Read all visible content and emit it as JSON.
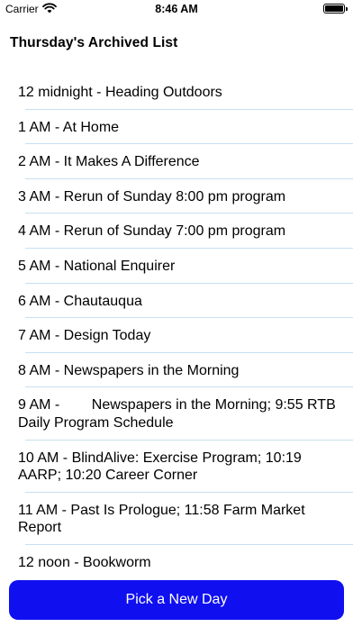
{
  "status_bar": {
    "carrier": "Carrier",
    "time": "8:46 AM"
  },
  "title": "Thursday's Archived List",
  "programs": [
    "12 midnight - Heading Outdoors",
    "1 AM - At Home",
    "2 AM - It Makes A Difference",
    "3 AM - Rerun of Sunday 8:00 pm program",
    "4 AM - Rerun of Sunday 7:00 pm program",
    "5 AM - National Enquirer",
    "6 AM - Chautauqua",
    "7 AM - Design Today",
    "8 AM - Newspapers in the Morning",
    "9 AM -        Newspapers in the Morning; 9:55 RTB Daily Program Schedule",
    "10 AM - BlindAlive: Exercise Program; 10:19 AARP; 10:20 Career Corner",
    "11 AM - Past Is Prologue; 11:58 Farm Market Report",
    "12 noon - Bookworm"
  ],
  "button": {
    "label": "Pick a New Day"
  },
  "colors": {
    "button_background": "#0f0ff0",
    "separator": "#c8dff0"
  }
}
